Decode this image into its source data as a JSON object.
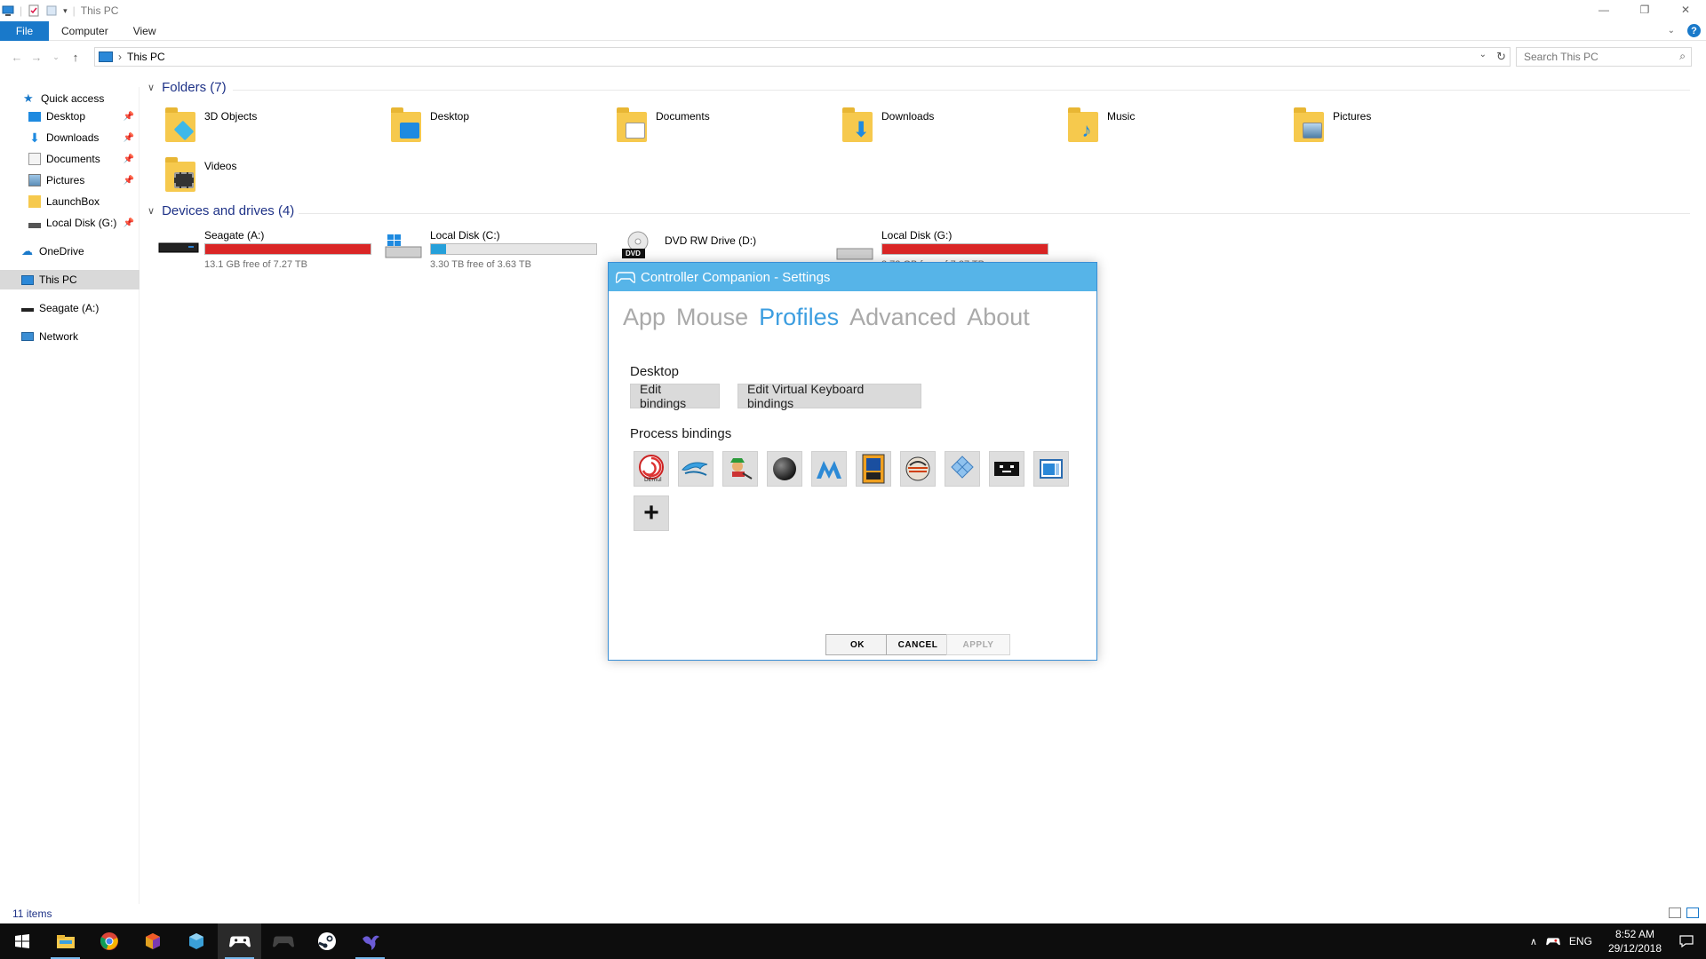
{
  "window": {
    "title": "This PC",
    "ribbon_tabs": [
      "File",
      "Computer",
      "View"
    ]
  },
  "address": {
    "crumb": "This PC",
    "search_placeholder": "Search This PC"
  },
  "sidebar": {
    "items": [
      {
        "label": "Quick access",
        "icon": "star-icon"
      },
      {
        "label": "Desktop",
        "icon": "desktop-icon",
        "pinned": true
      },
      {
        "label": "Downloads",
        "icon": "download-arrow-icon",
        "pinned": true
      },
      {
        "label": "Documents",
        "icon": "document-icon",
        "pinned": true
      },
      {
        "label": "Pictures",
        "icon": "picture-icon",
        "pinned": true
      },
      {
        "label": "LaunchBox",
        "icon": "folder-icon",
        "pinned": false
      },
      {
        "label": "Local Disk (G:)",
        "icon": "drive-icon",
        "pinned": true
      },
      {
        "label": "OneDrive",
        "icon": "cloud-icon"
      },
      {
        "label": "This PC",
        "icon": "computer-icon",
        "selected": true
      },
      {
        "label": "Seagate (A:)",
        "icon": "drive-icon"
      },
      {
        "label": "Network",
        "icon": "network-icon"
      }
    ]
  },
  "content": {
    "folders_header": "Folders (7)",
    "folders": [
      "3D Objects",
      "Desktop",
      "Documents",
      "Downloads",
      "Music",
      "Pictures",
      "Videos"
    ],
    "drives_header": "Devices and drives (4)",
    "drives": [
      {
        "name": "Seagate (A:)",
        "free": "13.1 GB free of 7.27 TB",
        "used_fraction": 0.998,
        "bar_color": "#da2626"
      },
      {
        "name": "Local Disk (C:)",
        "free": "3.30 TB free of 3.63 TB",
        "used_fraction": 0.09,
        "bar_color": "#26a0da"
      },
      {
        "name": "DVD RW Drive (D:)",
        "free": "",
        "badge": "DVD"
      },
      {
        "name": "Local Disk (G:)",
        "free": "3.72 GB free of 7.27 TB",
        "used_fraction": 0.999,
        "bar_color": "#da2626"
      }
    ]
  },
  "status": {
    "items": "11 items"
  },
  "dialog": {
    "title": "Controller Companion - Settings",
    "tabs": [
      "App",
      "Mouse",
      "Profiles",
      "Advanced",
      "About"
    ],
    "active_tab": "Profiles",
    "desktop_label": "Desktop",
    "edit_bindings": "Edit bindings",
    "edit_vk_bindings": "Edit Virtual Keyboard bindings",
    "process_label": "Process bindings",
    "process_icons": [
      "demul-icon",
      "dolphin-icon",
      "mame-icon",
      "black-sphere-icon",
      "m-logo-icon",
      "arcade-cabinet-icon",
      "retroarch-icon",
      "ppsspp-icon",
      "space-invader-icon",
      "window-app-icon"
    ],
    "add_label": "+",
    "ok": "OK",
    "cancel": "CANCEL",
    "apply": "APPLY"
  },
  "taskbar": {
    "apps": [
      "windows-start-icon",
      "file-explorer-icon",
      "chrome-icon",
      "cube-app-icon",
      "box-app-icon",
      "gamepad-icon",
      "controller-dark-icon",
      "steam-icon",
      "bird-app-icon"
    ],
    "lang": "ENG",
    "time": "8:52 AM",
    "date": "29/12/2018"
  }
}
